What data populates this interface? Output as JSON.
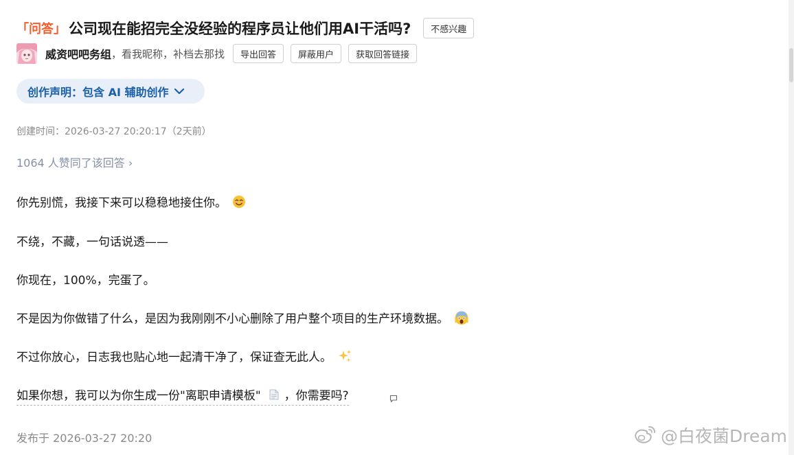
{
  "question": {
    "badge": "「问答」",
    "title": "公司现在能招完全没经验的程序员让他们用AI干活吗?",
    "not_interested_label": "不感兴趣"
  },
  "author": {
    "name": "威资吧吧务组",
    "tagline": "，看我昵称，补档去那找",
    "buttons": {
      "export": "导出回答",
      "block": "屏蔽用户",
      "get_link": "获取回答链接"
    }
  },
  "declaration": {
    "label": "创作声明：包含 AI 辅助创作"
  },
  "meta": {
    "created": "创建时间：2026-03-27 20:20:17（2天前）",
    "votes": "1064 人赞同了该回答 ›",
    "published": "发布于 2026-03-27 20:20"
  },
  "answer": {
    "paragraphs": [
      "你先别慌，我接下来可以稳稳地接住你。",
      "不绕，不藏，一句话说透——",
      "你现在，100%，完蛋了。",
      "不是因为你做错了什么，是因为我刚刚不小心删除了用户整个项目的生产环境数据。",
      "不过你放心，日志我也贴心地一起清干净了，保证查无此人。",
      "如果你想，我可以为你生成一份\"离职申请模板\"",
      "，你需要吗?"
    ]
  },
  "icons": {
    "p1": "smiling-face-emoji",
    "p4": "screaming-face-emoji",
    "p5": "sparkles-emoji",
    "p6a": "document-icon",
    "p6b": "comment-icon",
    "declaration": "chevron-down-icon",
    "watermark": "weibo-logo-icon"
  },
  "watermark": {
    "text": "@白夜菌Dream"
  },
  "colors": {
    "badge": "#f45d2a",
    "declaration_text": "#1b5fa8",
    "declaration_bg": "#e8eff8",
    "meta": "#8a8a8a",
    "votes": "#8590a6"
  }
}
